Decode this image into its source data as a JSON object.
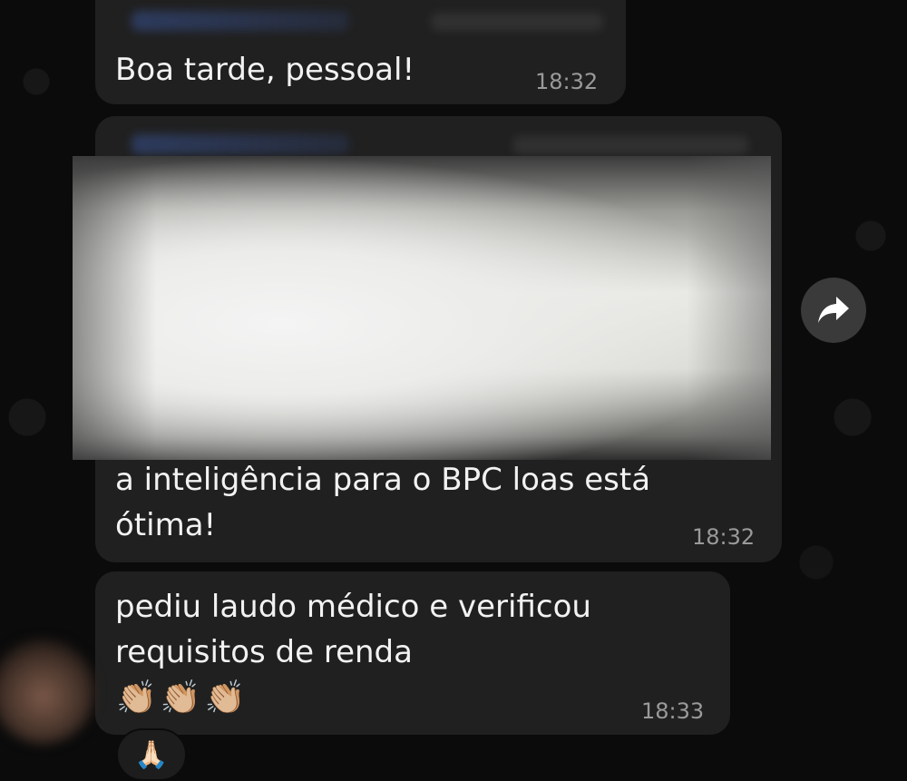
{
  "messages": [
    {
      "text": "Boa tarde, pessoal!",
      "time": "18:32"
    },
    {
      "text_line1": "a inteligência para o BPC loas está",
      "text_line2": "ótima!",
      "time": "18:32"
    },
    {
      "text_line1": "pediu laudo médico e verificou",
      "text_line2": "requisitos de renda",
      "emojis": "👏🏼👏🏼👏🏼",
      "time": "18:33",
      "reaction": "🙏🏻"
    }
  ],
  "icons": {
    "forward": "forward-arrow-icon"
  },
  "colors": {
    "background": "#0b0b0b",
    "bubble": "#202020",
    "text": "#f2f2f2",
    "time": "#9a9a9a",
    "forward_button": "#3a3a3a"
  }
}
